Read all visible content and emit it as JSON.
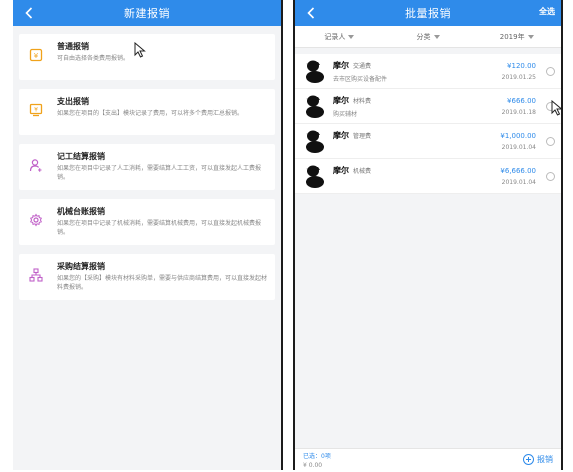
{
  "left_screen": {
    "title": "新建报销",
    "items": [
      {
        "name": "普通报销",
        "desc": "可自由选择各类费用报销。"
      },
      {
        "name": "支出报销",
        "desc": "如果您在项目的【支出】模块记录了费用，可以将多个费用汇总报销。"
      },
      {
        "name": "记工结算报销",
        "desc": "如果您在项目中记录了人工消耗，需要结算人工工资，可以直接发起人工费报销。"
      },
      {
        "name": "机械台账报销",
        "desc": "如果您在项目中记录了机械消耗，需要结算机械费用，可以直接发起机械费报销。"
      },
      {
        "name": "采购结算报销",
        "desc": "如果您的【采购】模块有材料采购单，需要与供应商结算费用，可以直接发起材料费报销。"
      }
    ],
    "icon_colors": [
      "#f0a21b",
      "#f0a21b",
      "#c060c8",
      "#c060c8",
      "#c060c8"
    ]
  },
  "right_screen": {
    "title": "批量报销",
    "select_all": "全选",
    "filters": [
      {
        "label": "记录人"
      },
      {
        "label": "分类"
      },
      {
        "label": "2019年"
      }
    ],
    "records": [
      {
        "person": "摩尔",
        "category": "交通费",
        "note": "去市区购买设备配件",
        "amount": "¥120.00",
        "date": "2019.01.25"
      },
      {
        "person": "摩尔",
        "category": "材料费",
        "note": "购买辅材",
        "amount": "¥666.00",
        "date": "2019.01.18"
      },
      {
        "person": "摩尔",
        "category": "管理费",
        "note": "",
        "amount": "¥1,000.00",
        "date": "2019.01.04"
      },
      {
        "person": "摩尔",
        "category": "机械费",
        "note": "",
        "amount": "¥6,666.00",
        "date": "2019.01.04"
      }
    ],
    "footer": {
      "selected": "已选：0项",
      "total": "¥ 0.00",
      "action": "报销"
    }
  },
  "accent_color": "#2f8bea"
}
